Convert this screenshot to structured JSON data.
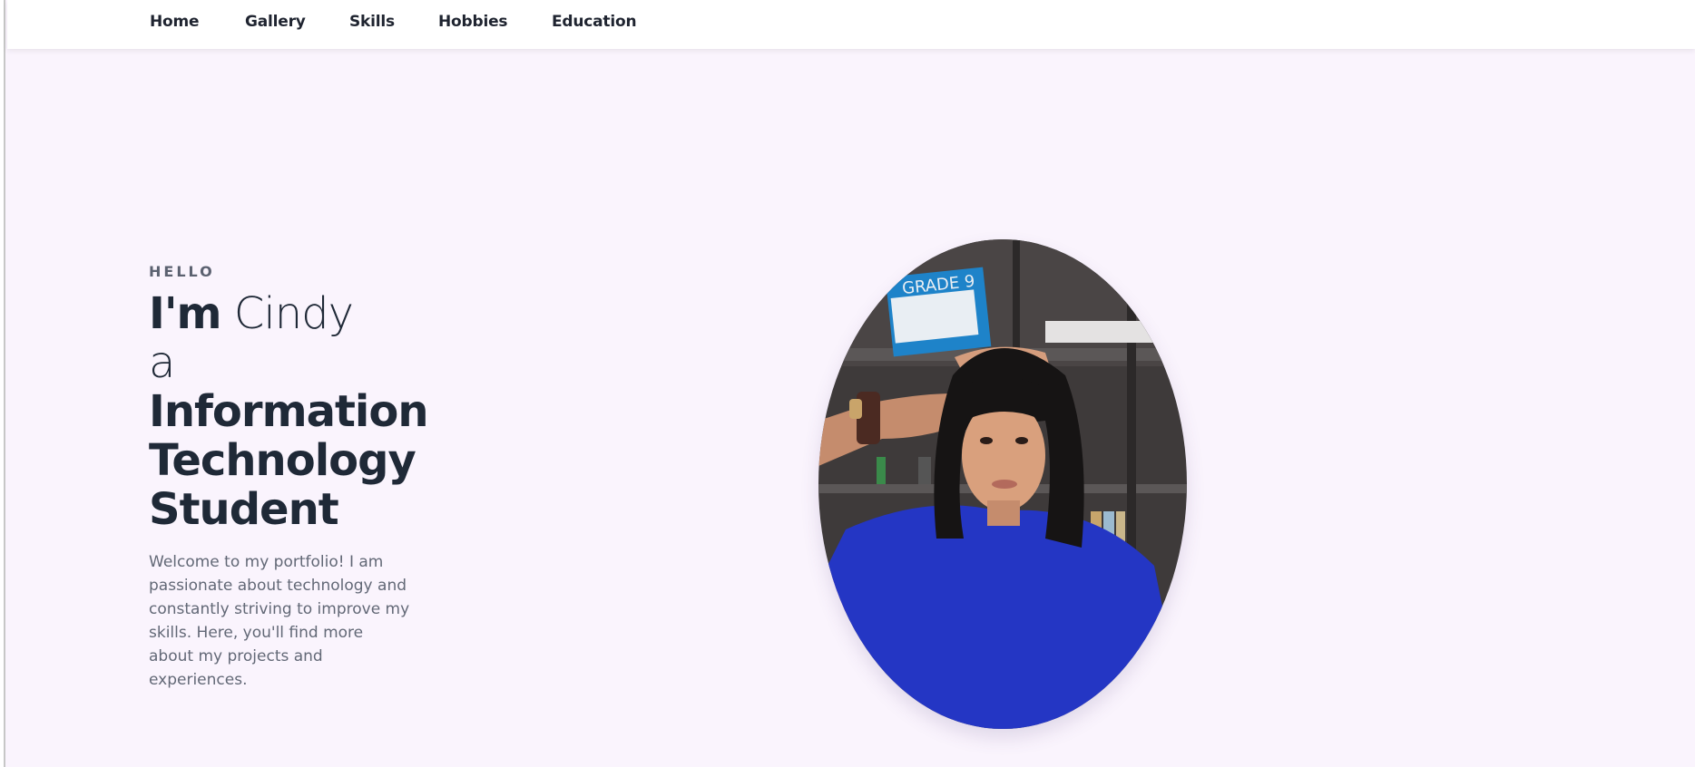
{
  "nav": {
    "items": [
      {
        "label": "Home"
      },
      {
        "label": "Gallery"
      },
      {
        "label": "Skills"
      },
      {
        "label": "Hobbies"
      },
      {
        "label": "Education"
      }
    ]
  },
  "hero": {
    "greeting": "HELLO",
    "im": "I'm",
    "name": "Cindy",
    "article": "a",
    "role_lines": [
      "Information",
      "Technology",
      "Student"
    ],
    "intro": "Welcome to my portfolio! I am passionate about technology and constantly striving to improve my skills. Here, you'll find more about my projects and experiences.",
    "box_label": "GRADE 9"
  },
  "colors": {
    "page_bg": "#faf4fd",
    "nav_bg": "#ffffff",
    "heading": "#1f2937",
    "body_text": "#626876",
    "shirt": "#2436c4"
  }
}
